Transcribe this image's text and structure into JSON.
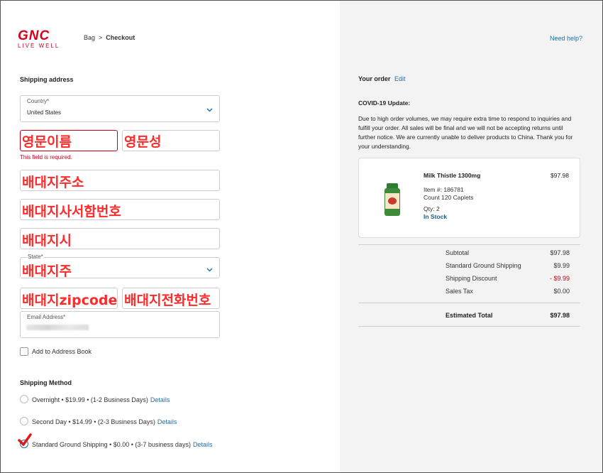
{
  "header": {
    "logo_main": "GNC",
    "logo_sub": "LIVE WELL",
    "breadcrumb_bag": "Bag",
    "breadcrumb_sep": ">",
    "breadcrumb_current": "Checkout",
    "need_help": "Need help?"
  },
  "shipping_address": {
    "title": "Shipping address",
    "country_label": "Country*",
    "country_value": "United States",
    "first_name_overlay": "영문이름",
    "last_name_overlay": "영문성",
    "error_message": "This field is required.",
    "address1_overlay": "배대지주소",
    "address2_overlay": "배대지사서함번호",
    "city_overlay": "배대지시",
    "state_label": "State*",
    "state_overlay": "배대지주",
    "zip_overlay": "배대지zipcode",
    "phone_overlay": "배대지전화번호",
    "email_label": "Email Address*",
    "add_to_address_book": "Add to Address Book"
  },
  "shipping_method": {
    "title": "Shipping Method",
    "options": [
      {
        "label": "Overnight • $19.99 • (1-2 Business Days)",
        "details": "Details"
      },
      {
        "label": "Second Day • $14.99 • (2-3 Business Days)",
        "details": "Details"
      },
      {
        "label": "Standard Ground Shipping • $0.00 • (3-7 business days)",
        "details": "Details"
      }
    ]
  },
  "order": {
    "title": "Your order",
    "edit": "Edit",
    "covid_title": "COVID-19 Update:",
    "covid_body": "Due to high order volumes, we may require extra time to respond to inquiries and fulfill your order. All sales will be final and we will not be accepting returns until further notice. We are currently unable to deliver products to China. Thank you for your understanding.",
    "item": {
      "name": "Milk Thistle 1300mg",
      "price": "$97.98",
      "item_no": "Item #: 186781",
      "count": "Count 120 Caplets",
      "qty": "Qty: 2",
      "stock": "In Stock"
    },
    "summary": [
      {
        "label": "Subtotal",
        "value": "$97.98"
      },
      {
        "label": "Standard Ground Shipping",
        "value": "$9.99"
      },
      {
        "label": "Shipping Discount",
        "value": "- $9.99"
      },
      {
        "label": "Sales Tax",
        "value": "$0.00"
      }
    ],
    "total_label": "Estimated Total",
    "total_value": "$97.98"
  },
  "colors": {
    "brand_red": "#d6001c",
    "link_blue": "#1f6fa8",
    "error_red": "#c40018",
    "overlay_red": "#ff2a2a"
  }
}
